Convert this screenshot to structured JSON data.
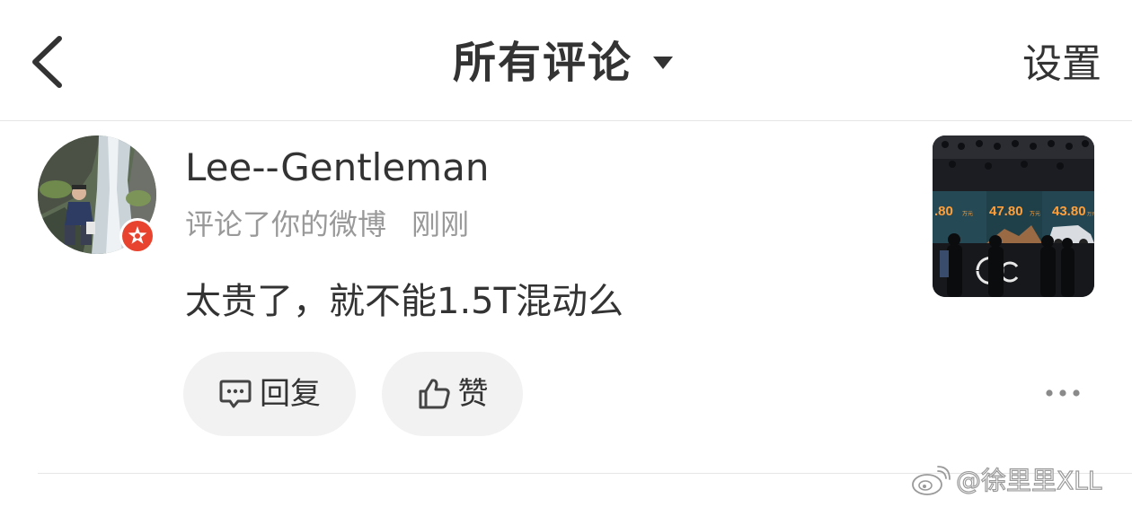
{
  "header": {
    "title": "所有评论",
    "settings_label": "设置",
    "icons": {
      "back": "chevron-left-icon",
      "dropdown": "caret-down-icon"
    }
  },
  "comment": {
    "username": "Lee--Gentleman",
    "action_text": "评论了你的微博",
    "time_text": "刚刚",
    "content": "太贵了，就不能1.5T混动么",
    "badge": "verified-badge-icon",
    "badge_color": "#e8432e",
    "actions": {
      "reply_label": "回复",
      "like_label": "赞",
      "icons": {
        "reply": "comment-bubble-icon",
        "like": "thumbs-up-icon",
        "more": "more-dots-icon"
      }
    },
    "thumbnail": {
      "prices": [
        ".80",
        "47.80",
        "43.80"
      ],
      "price_units": [
        "万元",
        "万元",
        "万元"
      ]
    }
  },
  "watermark": {
    "text": "@徐里里XLL",
    "icon": "weibo-logo-icon"
  },
  "colors": {
    "text_primary": "#333333",
    "text_secondary": "#999999",
    "pill_bg": "#f2f2f2",
    "divider": "#e6e6e6"
  }
}
